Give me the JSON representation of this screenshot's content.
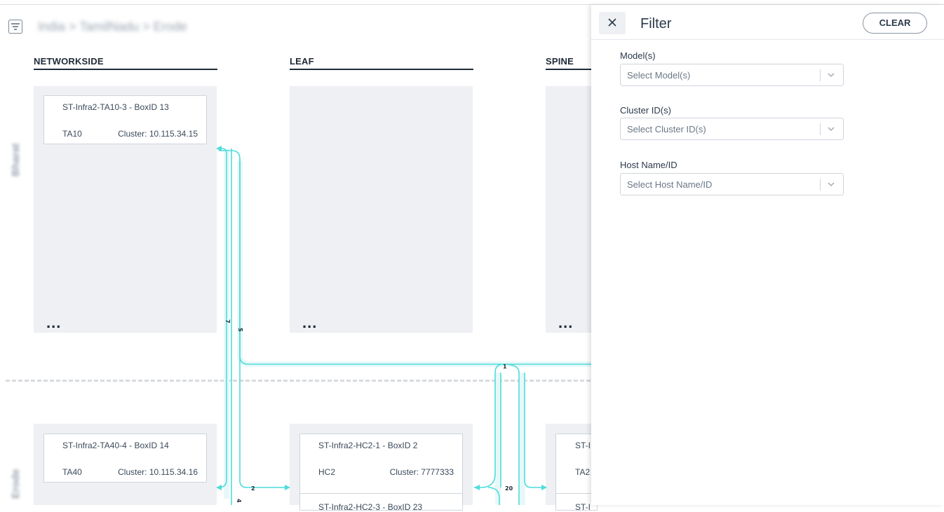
{
  "breadcrumb": "India > TamilNadu > Erode",
  "columns": {
    "networkside": "NETWORKSIDE",
    "leaf": "LEAF",
    "spine": "SPINE"
  },
  "side_labels": {
    "upper": "Bharat",
    "lower": "Erode"
  },
  "more_label": "...",
  "cards": {
    "ta10": {
      "name": "ST-Infra2-TA10-3 - BoxID 13",
      "model": "TA10",
      "cluster": "Cluster: 10.115.34.15"
    },
    "ta40": {
      "name": "ST-Infra2-TA40-4 - BoxID 14",
      "model": "TA40",
      "cluster": "Cluster: 10.115.34.16"
    },
    "hc2_1": {
      "name": "ST-Infra2-HC2-1 - BoxID 2",
      "model": "HC2",
      "cluster": "Cluster: 7777333"
    },
    "hc2_3": {
      "name": "ST-Infra2-HC2-3 - BoxID 23"
    },
    "spine_partial": {
      "name": "ST-I",
      "model": "TA2",
      "name2": "ST-I"
    }
  },
  "link_labels": {
    "l7": "7",
    "l5": "5",
    "l1": "1",
    "l2": "2",
    "l4": "4",
    "l20": "20"
  },
  "colors": {
    "link": "#4fdcdc",
    "panel": "#eef0f3",
    "text": "#2b3a4a"
  },
  "filter": {
    "title": "Filter",
    "close_icon": "close-icon",
    "clear_label": "CLEAR",
    "fields": [
      {
        "label": "Model(s)",
        "placeholder": "Select Model(s)"
      },
      {
        "label": "Cluster ID(s)",
        "placeholder": "Select Cluster ID(s)"
      },
      {
        "label": "Host Name/ID",
        "placeholder": "Select Host Name/ID"
      }
    ]
  }
}
